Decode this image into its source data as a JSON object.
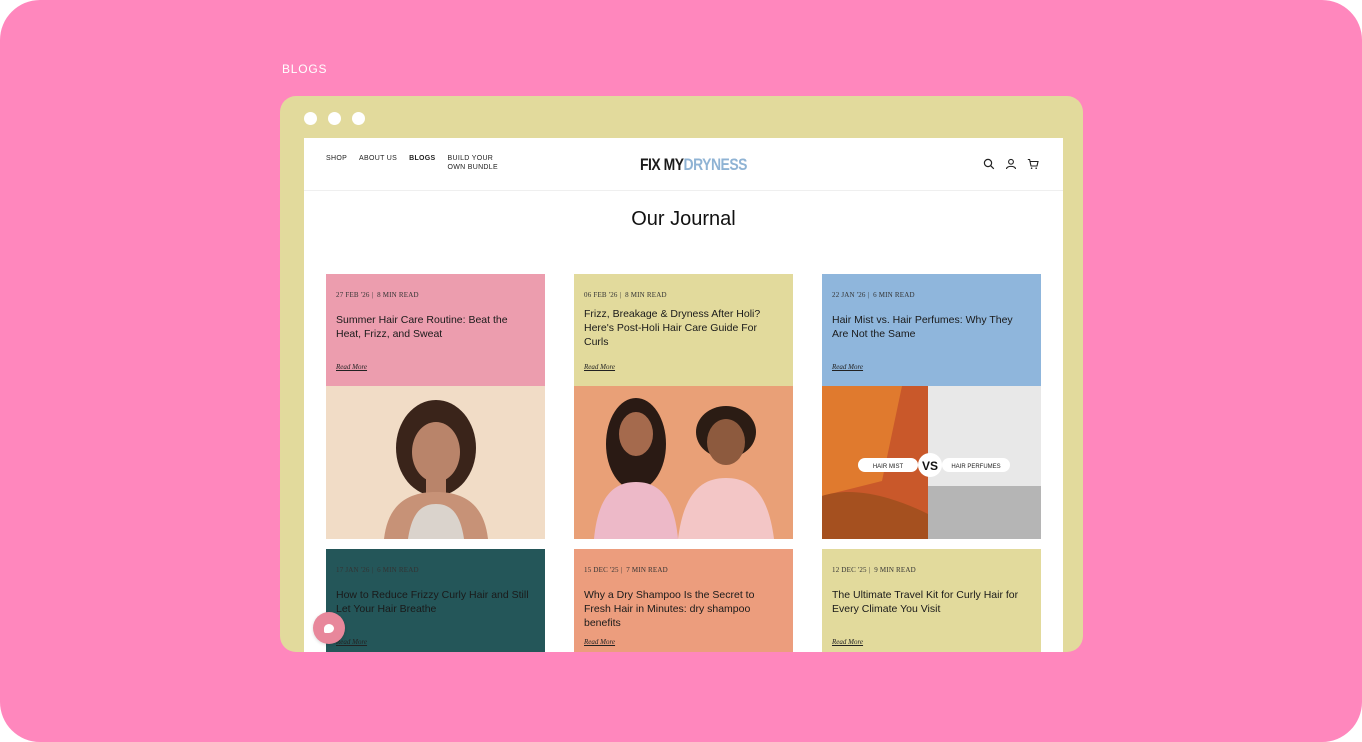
{
  "section_label": "BLOGS",
  "nav": {
    "items": [
      "SHOP",
      "ABOUT US",
      "BLOGS",
      "BUILD YOUR OWN BUNDLE"
    ],
    "active": "BLOGS"
  },
  "logo": {
    "part1": "FIX MY",
    "part2": "DRYNESS"
  },
  "header_icons": [
    "search-icon",
    "user-icon",
    "cart-icon"
  ],
  "page_title": "Our Journal",
  "posts": [
    {
      "date": "27 FEB '26",
      "read_time": "8 MIN READ",
      "title": "Summer Hair Care Routine: Beat the Heat, Frizz, and Sweat",
      "link": "Read More",
      "color": "#ec9dae"
    },
    {
      "date": "06 FEB '26",
      "read_time": "8 MIN READ",
      "title": "Frizz, Breakage & Dryness After Holi? Here's Post-Holi Hair Care Guide For Curls",
      "link": "Read More",
      "color": "#e2da9c"
    },
    {
      "date": "22 JAN '26",
      "read_time": "6 MIN READ",
      "title": "Hair Mist vs. Hair Perfumes: Why They Are Not the Same",
      "link": "Read More",
      "color": "#8fb6dc"
    },
    {
      "date": "17 JAN '26",
      "read_time": "6 MIN READ",
      "title": "How to Reduce Frizzy Curly Hair and Still Let Your Hair Breathe",
      "link": "Read More",
      "color": "#245659"
    },
    {
      "date": "15 DEC '25",
      "read_time": "7 MIN READ",
      "title": "Why a Dry Shampoo Is the Secret to Fresh Hair in Minutes: dry shampoo benefits",
      "link": "Read More",
      "color": "#ec9d7d"
    },
    {
      "date": "12 DEC '25",
      "read_time": "9 MIN READ",
      "title": "The Ultimate Travel Kit for Curly Hair for Every Climate You Visit",
      "link": "Read More",
      "color": "#e2da9c"
    }
  ],
  "image3_labels": {
    "left": "HAIR MIST",
    "vs": "VS",
    "right": "HAIR PERFUMES"
  }
}
